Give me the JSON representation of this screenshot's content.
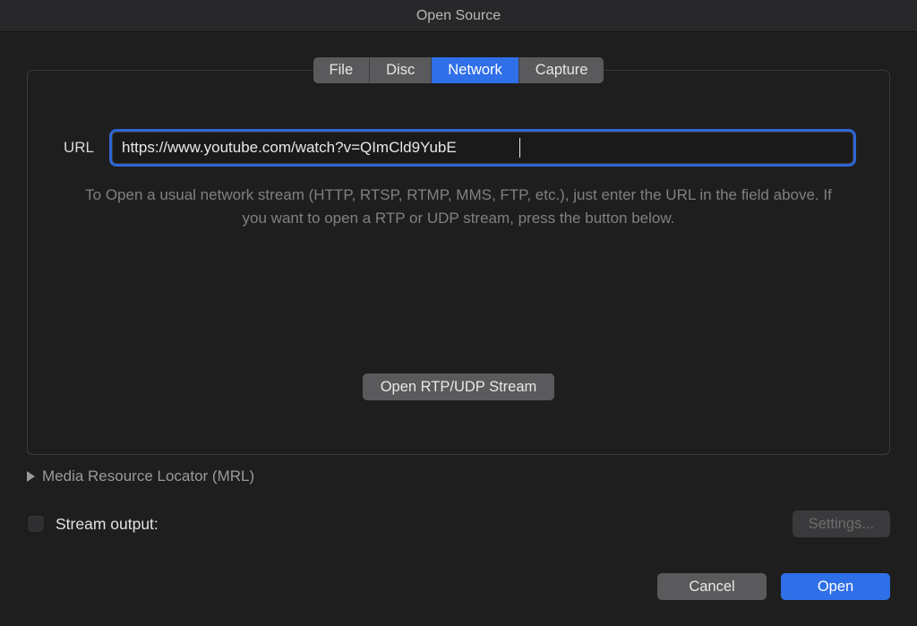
{
  "window": {
    "title": "Open Source"
  },
  "tabs": {
    "file": "File",
    "disc": "Disc",
    "network": "Network",
    "capture": "Capture",
    "active": "network"
  },
  "network": {
    "url_label": "URL",
    "url_value": "https://www.youtube.com/watch?v=QImCld9YubE",
    "help_text": "To Open a usual network stream (HTTP, RTSP, RTMP, MMS, FTP, etc.), just enter the URL in the field above. If you want to open a RTP or UDP stream, press the button below.",
    "rtp_button": "Open RTP/UDP Stream"
  },
  "mrl": {
    "label": "Media Resource Locator (MRL)"
  },
  "stream": {
    "label": "Stream output:",
    "checked": false,
    "settings_label": "Settings..."
  },
  "actions": {
    "cancel": "Cancel",
    "open": "Open"
  }
}
